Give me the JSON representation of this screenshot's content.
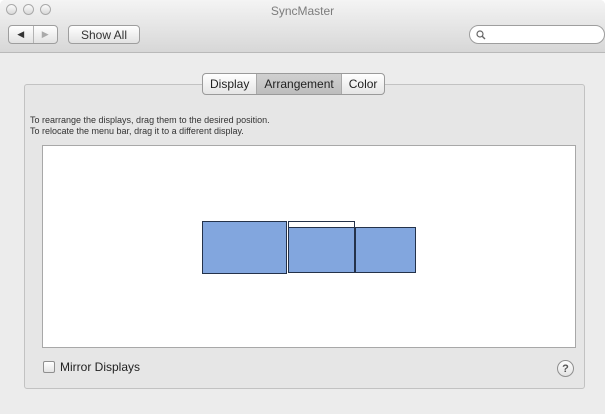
{
  "window": {
    "title": "SyncMaster"
  },
  "toolbar": {
    "back_icon": "triangle-left-icon",
    "forward_icon": "triangle-right-icon",
    "show_all_label": "Show All",
    "search_icon": "magnifier-icon",
    "search_value": ""
  },
  "tabs": [
    {
      "label": "Display",
      "selected": false
    },
    {
      "label": "Arrangement",
      "selected": true
    },
    {
      "label": "Color",
      "selected": false
    }
  ],
  "instructions": {
    "line1": "To rearrange the displays, drag them to the desired position.",
    "line2": "To relocate the menu bar, drag it to a different display."
  },
  "arrangement": {
    "display_color": "#82a6de",
    "display_count": 3
  },
  "mirror": {
    "label": "Mirror Displays",
    "checked": false
  },
  "help": {
    "label": "?"
  }
}
